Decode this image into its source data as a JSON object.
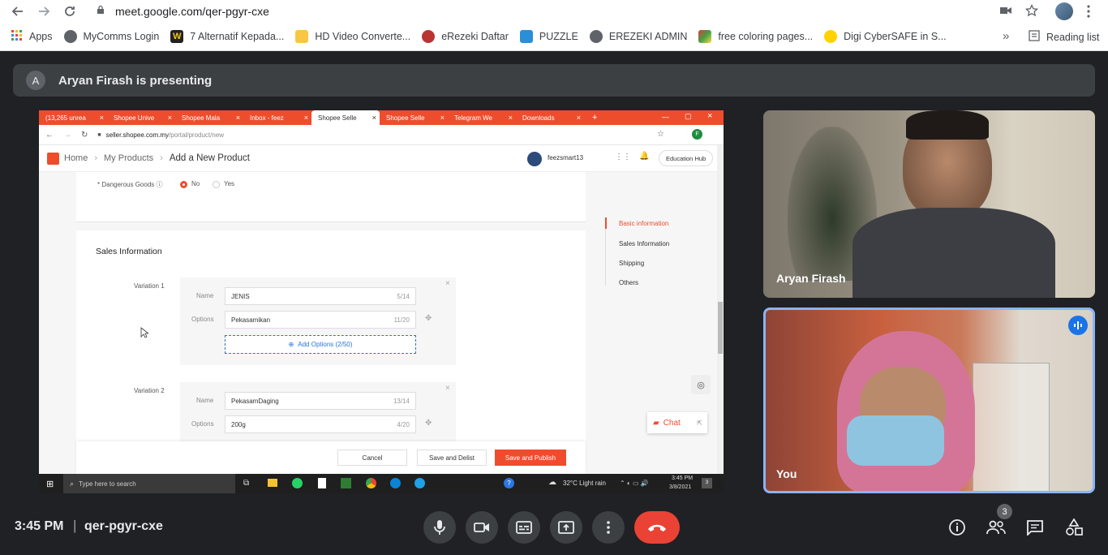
{
  "browser": {
    "url": "meet.google.com/qer-pgyr-cxe",
    "bookmarks": [
      "Apps",
      "MyComms Login",
      "7 Alternatif Kepada...",
      "HD Video Converte...",
      "eRezeki Daftar",
      "PUZZLE",
      "EREZEKI ADMIN",
      "free coloring pages...",
      "Digi CyberSAFE in S..."
    ],
    "overflow": "»",
    "reading_list": "Reading list"
  },
  "meet": {
    "presenter_initial": "A",
    "presenting_text": "Aryan Firash is presenting",
    "tiles": [
      {
        "name": "Aryan Firash"
      },
      {
        "name": "You"
      }
    ],
    "time": "3:45 PM",
    "separator": "|",
    "meeting_code": "qer-pgyr-cxe",
    "participants_count": "3",
    "colors": {
      "background": "#202124",
      "end_call": "#ea4335",
      "accent": "#8ab4f8"
    }
  },
  "shared_screen": {
    "tabs": [
      "(13,265 unrea",
      "Shopee Unive",
      "Shopee Mala",
      "Inbox - feez",
      "Shopee Selle",
      "Shopee Selle",
      "Telegram We",
      "Downloads"
    ],
    "url_domain": "seller.shopee.com.my",
    "url_path": "/portal/product/new",
    "breadcrumb": [
      "Home",
      "My Products",
      "Add a New Product"
    ],
    "username": "feezsmart13",
    "avatar_letter": "F",
    "education_hub": "Education Hub",
    "dangerous_goods_label": "* Dangerous Goods ⓘ",
    "dg_no": "No",
    "dg_yes": "Yes",
    "sales_title": "Sales Information",
    "variation1": {
      "label": "Variation 1",
      "name_label": "Name",
      "name_value": "JENIS",
      "name_count": "5/14",
      "options_label": "Options",
      "option_value": "Pekasamikan",
      "option_count": "11/20",
      "add_options": "Add Options (2/50)"
    },
    "variation2": {
      "label": "Variation 2",
      "name_label": "Name",
      "name_value": "PekasamDaging",
      "name_count": "13/14",
      "options_label": "Options",
      "option_value": "200g",
      "option_count": "4/20"
    },
    "side_nav": [
      "Basic information",
      "Sales Information",
      "Shipping",
      "Others"
    ],
    "chat_label": "Chat",
    "buttons": {
      "cancel": "Cancel",
      "save_delist": "Save and Delist",
      "save_publish": "Save and Publish"
    },
    "taskbar": {
      "search": "Type here to search",
      "weather": "32°C  Light rain",
      "time": "3:45 PM",
      "date": "3/8/2021",
      "notif_count": "3"
    },
    "colors": {
      "shopee": "#ee4d2d"
    }
  }
}
